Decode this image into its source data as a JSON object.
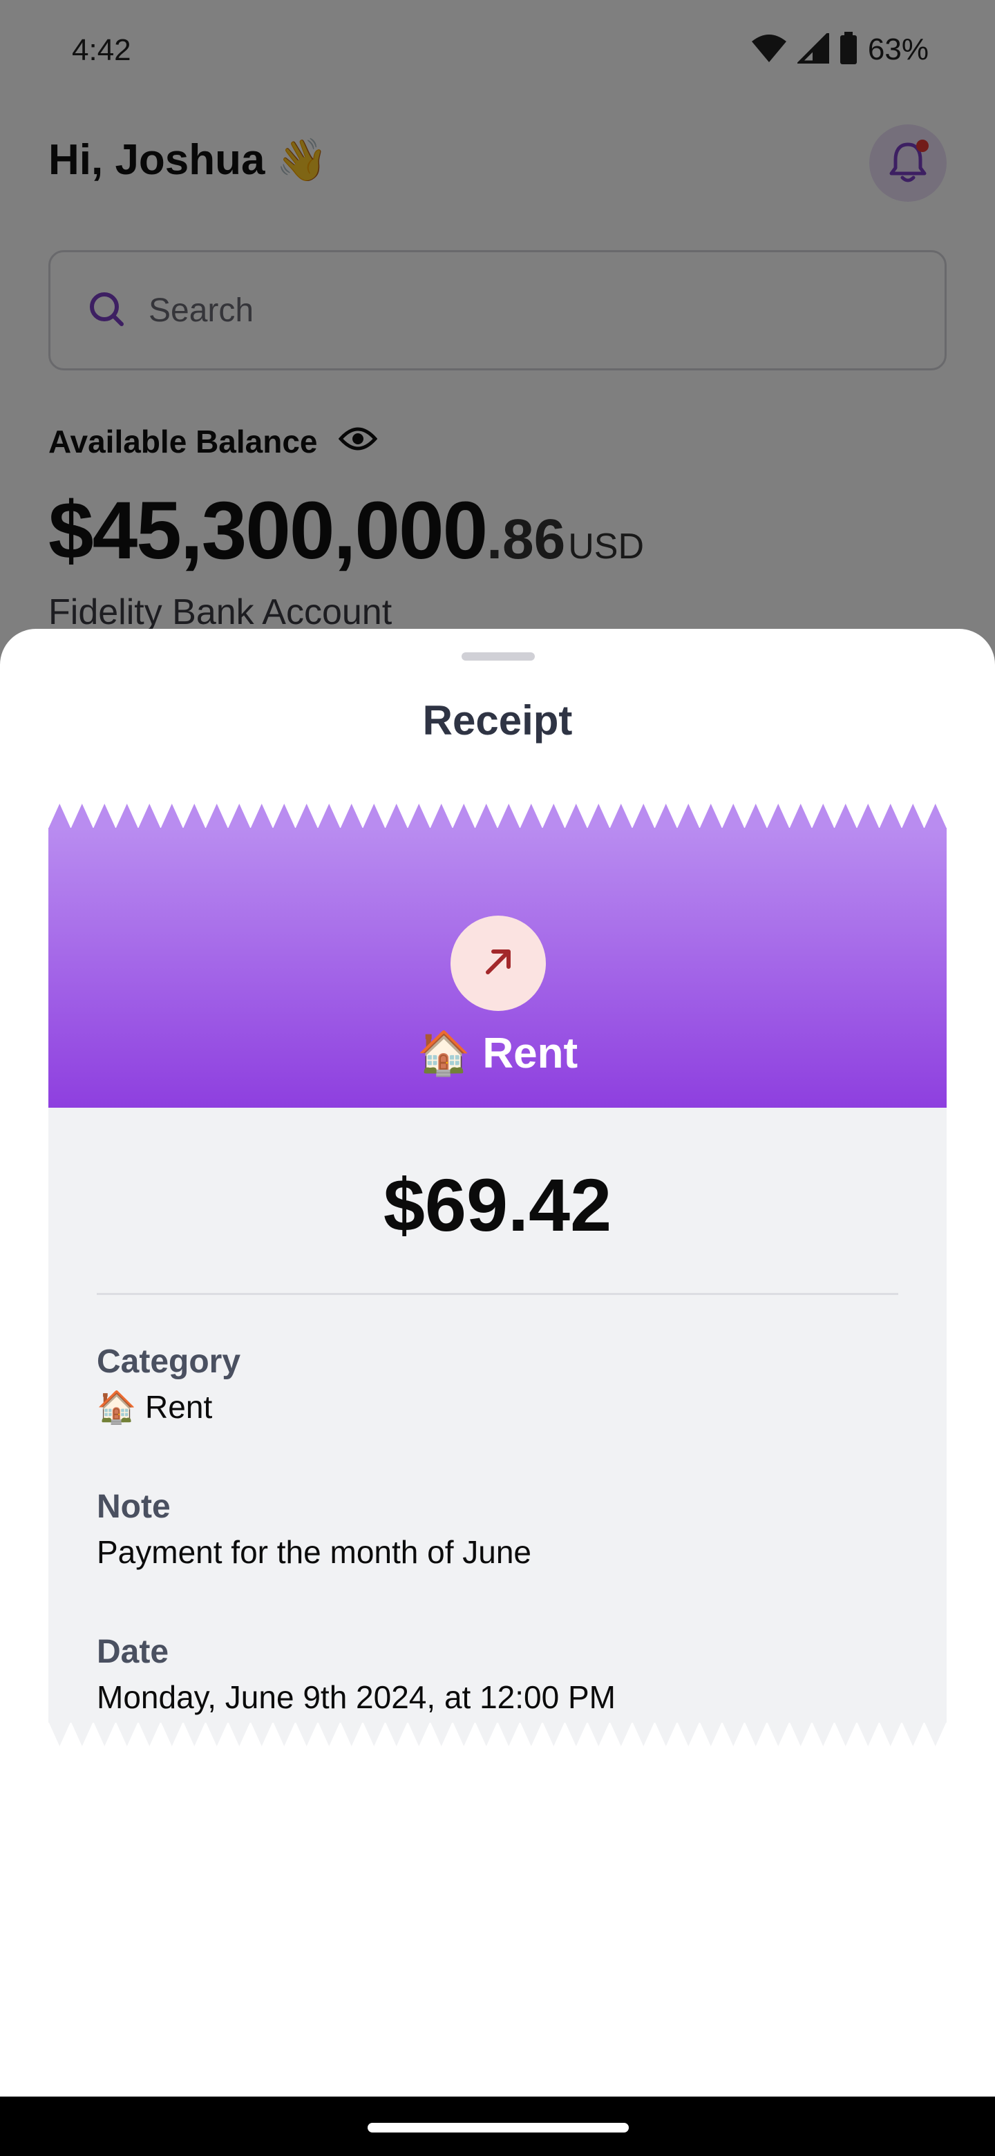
{
  "status_bar": {
    "time": "4:42",
    "battery_percent": "63%",
    "icons": [
      "wifi-icon",
      "signal-icon",
      "battery-icon"
    ]
  },
  "home": {
    "greeting": "Hi, Joshua",
    "greeting_emoji": "👋",
    "notification_icon": "bell-icon",
    "search": {
      "placeholder": "Search",
      "icon": "search-icon"
    },
    "balance": {
      "label": "Available Balance",
      "visibility_icon": "eye-icon",
      "amount_main": "$45,300,000",
      "amount_cents": ".86",
      "currency": "USD",
      "account_name": "Fidelity Bank Account"
    }
  },
  "receipt_sheet": {
    "title": "Receipt",
    "direction_icon": "arrow-up-right-icon",
    "category_header": "🏠 Rent",
    "amount": "$69.42",
    "fields": [
      {
        "label": "Category",
        "value": "🏠 Rent"
      },
      {
        "label": "Note",
        "value": "Payment for the month of June"
      },
      {
        "label": "Date",
        "value": "Monday, June 9th 2024, at 12:00 PM"
      }
    ]
  },
  "colors": {
    "accent": "#8e3fdf",
    "accent_light": "#b98cf0",
    "outgoing_bg": "#fbe3e1",
    "outgoing_arrow": "#a3282b",
    "receipt_body": "#f1f2f4"
  }
}
